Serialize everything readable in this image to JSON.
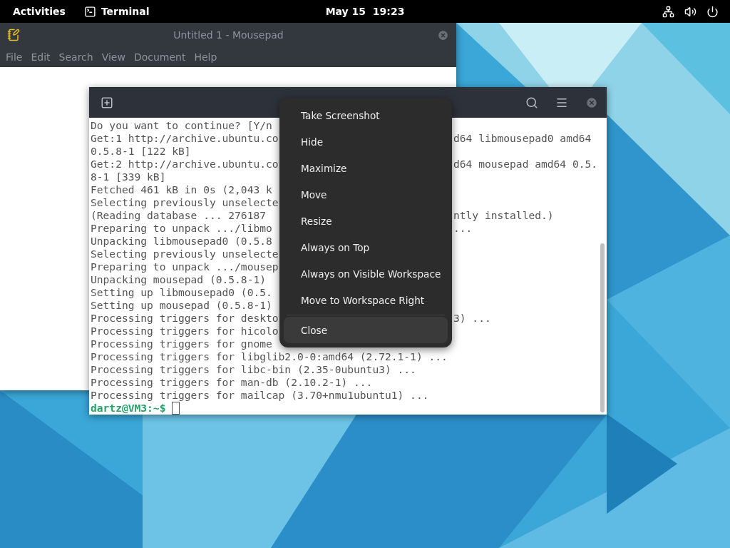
{
  "top_bar": {
    "activities": "Activities",
    "app_name": "Terminal",
    "clock": "May 15  19:23"
  },
  "mousepad": {
    "title": "Untitled 1 - Mousepad",
    "menu": [
      "File",
      "Edit",
      "Search",
      "View",
      "Document",
      "Help"
    ]
  },
  "terminal": {
    "lines": [
      {
        "left": "Do you want to continue? [Y/n"
      },
      {
        "left": "Get:1 http://archive.ubuntu.co",
        "right": "d64 libmousepad0 amd64"
      },
      {
        "left": "0.5.8-1 [122 kB]"
      },
      {
        "left": "Get:2 http://archive.ubuntu.co",
        "right": "d64 mousepad amd64 0.5."
      },
      {
        "left": "8-1 [339 kB]"
      },
      {
        "left": "Fetched 461 kB in 0s (2,043 k"
      },
      {
        "left": "Selecting previously unselecte"
      },
      {
        "left": "(Reading database ... 276187",
        "right": "ntly installed.)"
      },
      {
        "left": "Preparing to unpack .../libmo",
        "right": "..."
      },
      {
        "left": "Unpacking libmousepad0 (0.5.8"
      },
      {
        "left": "Selecting previously unselecte"
      },
      {
        "left": "Preparing to unpack .../mousep"
      },
      {
        "left": "Unpacking mousepad (0.5.8-1)"
      },
      {
        "left": "Setting up libmousepad0 (0.5."
      },
      {
        "left": "Setting up mousepad (0.5.8-1)"
      },
      {
        "left": "Processing triggers for deskto",
        "right": "3) ..."
      },
      {
        "left": "Processing triggers for hicolo"
      },
      {
        "left": "Processing triggers for gnome"
      },
      {
        "left": "Processing triggers for libglib2.0-0:amd64 (2.72.1-1) ..."
      },
      {
        "left": "Processing triggers for libc-bin (2.35-0ubuntu3) ..."
      },
      {
        "left": "Processing triggers for man-db (2.10.2-1) ..."
      },
      {
        "left": "Processing triggers for mailcap (3.70+nmu1ubuntu1) ..."
      }
    ],
    "prompt": "dartz@VM3:~$"
  },
  "context_menu": {
    "groups": [
      [
        {
          "label": "Take Screenshot",
          "selected": false
        },
        {
          "label": "Hide",
          "selected": false
        },
        {
          "label": "Maximize",
          "selected": false
        },
        {
          "label": "Move",
          "selected": false
        },
        {
          "label": "Resize",
          "selected": false
        },
        {
          "label": "Always on Top",
          "selected": false
        },
        {
          "label": "Always on Visible Workspace",
          "selected": false
        },
        {
          "label": "Move to Workspace Right",
          "selected": false
        }
      ],
      [
        {
          "label": "Close",
          "selected": true
        }
      ]
    ]
  }
}
